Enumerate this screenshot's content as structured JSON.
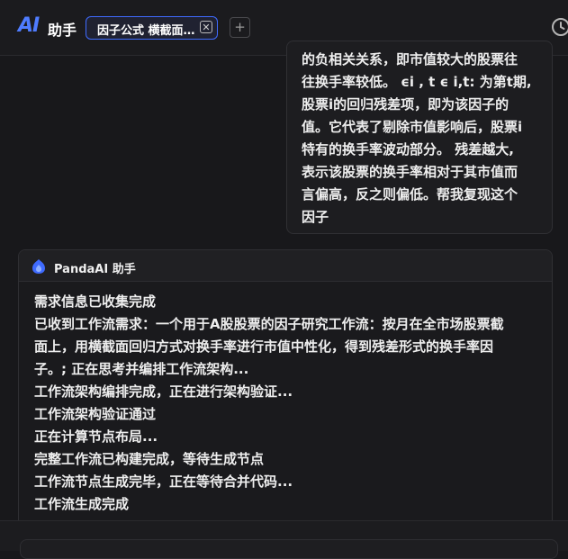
{
  "header": {
    "logo_text": "AI",
    "app_title": "助手",
    "tab_label": "因子公式 横截面...",
    "tab_close": "✕",
    "add_tab": "+"
  },
  "user_message": {
    "lines": [
      "的负相关关系，即市值较大的股票往",
      "往换手率较低。 ϵi , t ϵ i,t: 为第t期,",
      "股票i的回归残差项，即为该因子的",
      "值。它代表了剔除市值影响后，股票i",
      "特有的换手率波动部分。 残差越大,",
      "表示该股票的换手率相对于其市值而",
      "言偏高，反之则偏低。帮我复现这个",
      "因子"
    ]
  },
  "assistant": {
    "name": "PandaAI 助手",
    "lines": [
      "需求信息已收集完成",
      "已收到工作流需求：一个用于A股股票的因子研究工作流：按月在全市场股票截",
      "面上，用横截面回归方式对换手率进行市值中性化，得到残差形式的换手率因",
      "子。; 正在思考并编排工作流架构...",
      "工作流架构编排完成，正在进行架构验证...",
      "工作流架构验证通过",
      "正在计算节点布局...",
      "完整工作流已构建完成，等待生成节点",
      "工作流节点生成完毕，正在等待合并代码...",
      "工作流生成完成"
    ]
  },
  "colors": {
    "accent": "#4f7cff",
    "background": "#18181b"
  }
}
